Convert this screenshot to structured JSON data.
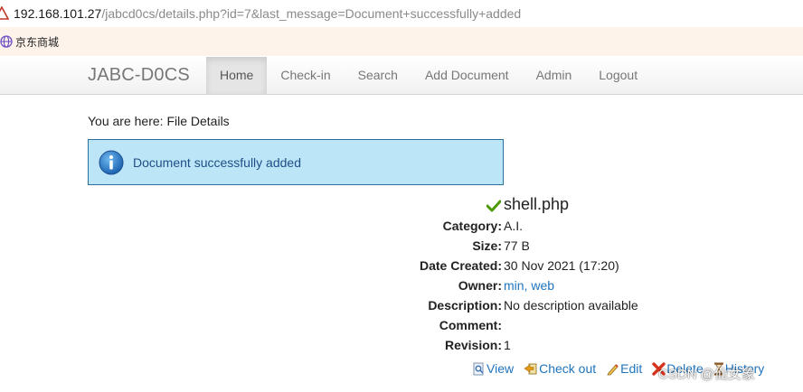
{
  "browser": {
    "url_host": "192.168.101.27",
    "url_rest": "/jabcd0cs/details.php?id=7&last_message=Document+successfully+added",
    "bookmarks": [
      {
        "label": "京东商城",
        "icon": "globe-icon"
      }
    ]
  },
  "navbar": {
    "brand": "JABC-D0CS",
    "items": [
      {
        "label": "Home",
        "active": true
      },
      {
        "label": "Check-in"
      },
      {
        "label": "Search"
      },
      {
        "label": "Add Document"
      },
      {
        "label": "Admin"
      },
      {
        "label": "Logout"
      }
    ]
  },
  "breadcrumb": "You are here: File Details",
  "alert": {
    "message": "Document successfully added",
    "icon": "info-icon",
    "bg": "#bde5f8",
    "border": "#2b6e9c"
  },
  "file": {
    "name": "shell.php",
    "status_icon": "checkmark-icon",
    "fields": [
      {
        "label": "Category:",
        "value": "A.I."
      },
      {
        "label": "Size:",
        "value": "77 B"
      },
      {
        "label": "Date Created:",
        "value": "30 Nov 2021 (17:20)"
      },
      {
        "label": "Owner:",
        "value": "min, web",
        "is_link": true
      },
      {
        "label": "Description:",
        "value": "No description available"
      },
      {
        "label": "Comment:",
        "value": ""
      },
      {
        "label": "Revision:",
        "value": "1"
      }
    ]
  },
  "actions": [
    {
      "label": "View",
      "icon": "view-icon"
    },
    {
      "label": "Check out",
      "icon": "checkout-icon"
    },
    {
      "label": "Edit",
      "icon": "edit-icon"
    },
    {
      "label": "Delete",
      "icon": "delete-icon"
    },
    {
      "label": "History",
      "icon": "history-icon"
    }
  ],
  "watermark": "CSDN @仙女象",
  "colors": {
    "link": "#1f74bd",
    "bookmarks_bar": "#fdf3ea"
  }
}
